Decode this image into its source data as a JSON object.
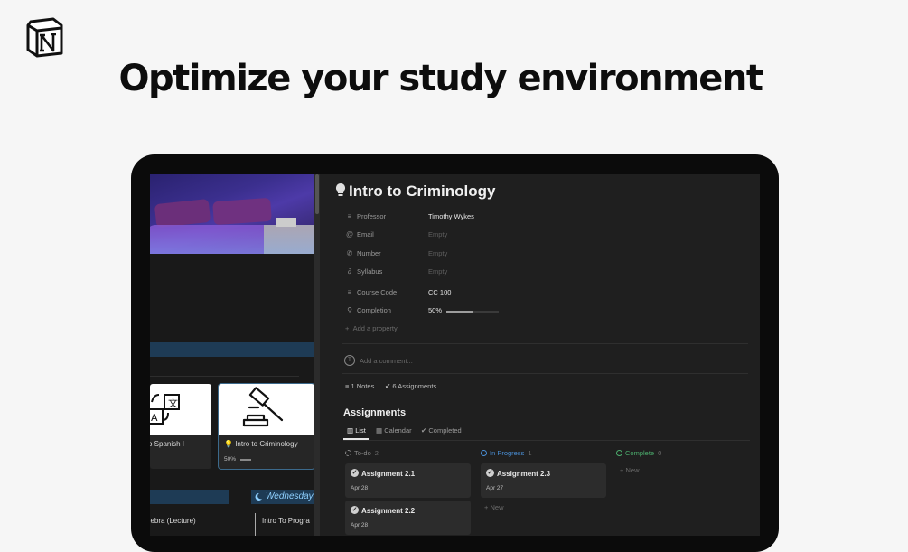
{
  "headline": "Optimize your study environment",
  "left": {
    "cards": [
      {
        "title": "o Spanish I"
      },
      {
        "title": "Intro to Criminology",
        "progress": "50%",
        "progress_value": 0.5
      }
    ],
    "calendar": {
      "day": "Wednesday",
      "lectures": [
        "gebra (Lecture)",
        "Intro To Progra"
      ]
    }
  },
  "page": {
    "title": "Intro to Criminology",
    "properties": [
      {
        "icon": "list-icon",
        "label": "Professor",
        "value": "Timothy Wykes",
        "empty": false
      },
      {
        "icon": "at-icon",
        "label": "Email",
        "value": "Empty",
        "empty": true
      },
      {
        "icon": "phone-icon",
        "label": "Number",
        "value": "Empty",
        "empty": true
      },
      {
        "icon": "paperclip-icon",
        "label": "Syllabus",
        "value": "Empty",
        "empty": true
      },
      {
        "icon": "list-icon",
        "label": "Course Code",
        "value": "CC 100",
        "empty": false
      },
      {
        "icon": "search-icon",
        "label": "Completion",
        "value": "50%",
        "empty": false
      }
    ],
    "completion_value": 0.5,
    "add_property": "Add a property",
    "comment_placeholder": "Add a comment...",
    "relations": {
      "notes": "1 Notes",
      "assignments": "6 Assignments"
    },
    "assignments": {
      "title": "Assignments",
      "tabs": [
        "List",
        "Calendar",
        "Completed"
      ],
      "columns": [
        {
          "name": "To-do",
          "count": "2",
          "color": "#8a8a8a"
        },
        {
          "name": "In Progress",
          "count": "1",
          "color": "#4a8fd6"
        },
        {
          "name": "Complete",
          "count": "0",
          "color": "#4caf6e"
        }
      ],
      "cards": [
        {
          "title": "Assignment 2.1",
          "date": "Apr 28"
        },
        {
          "title": "Assignment 2.2",
          "date": "Apr 28"
        },
        {
          "title": "Assignment 2.3",
          "date": "Apr 27"
        }
      ],
      "new_label": "New"
    }
  }
}
